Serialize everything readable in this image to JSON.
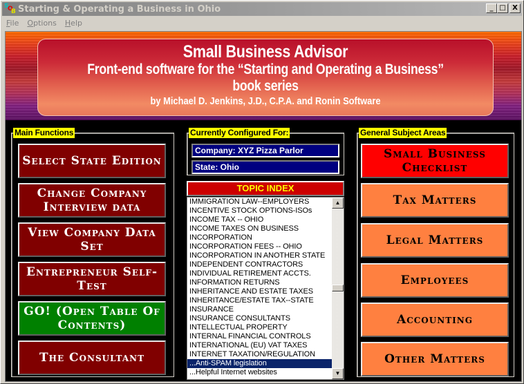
{
  "window": {
    "title": "Starting & Operating a Business in Ohio",
    "icon_letters": [
      "S",
      "O",
      "B"
    ],
    "controls": {
      "minimize": "_",
      "maximize": "□",
      "close": "X"
    }
  },
  "menu": [
    {
      "label": "File",
      "accel": "F",
      "rest": "ile"
    },
    {
      "label": "Options",
      "accel": "O",
      "rest": "ptions"
    },
    {
      "label": "Help",
      "accel": "H",
      "rest": "elp"
    }
  ],
  "banner": {
    "title": "Small Business Advisor",
    "subtitle_line1": "Front-end software for the “Starting and Operating a Business”",
    "subtitle_line2": "book series",
    "byline": "by Michael D. Jenkins, J.D., C.P.A. and Ronin Software"
  },
  "main_functions": {
    "label": "Main Functions",
    "buttons": [
      {
        "label": "Select State Edition",
        "style": "maroon"
      },
      {
        "label": "Change Company Interview data",
        "style": "maroon"
      },
      {
        "label": "View Company Data Set",
        "style": "maroon"
      },
      {
        "label": "Entrepreneur Self-Test",
        "style": "maroon"
      },
      {
        "label": "GO! (Open Table Of Contents)",
        "style": "green"
      },
      {
        "label": "The Consultant",
        "style": "maroon"
      }
    ]
  },
  "configured_for": {
    "label": "Currently Configured For:",
    "company": "Company: XYZ Pizza Parlor",
    "state": "State: Ohio"
  },
  "topic_index": {
    "header": "TOPIC INDEX",
    "items": [
      "IMMIGRATION LAW--EMPLOYERS",
      "INCENTIVE STOCK OPTIONS-ISOs",
      "INCOME TAX -- OHIO",
      "INCOME TAXES ON BUSINESS",
      "INCORPORATION",
      "INCORPORATION FEES -- OHIO",
      "INCORPORATION IN ANOTHER STATE",
      "INDEPENDENT CONTRACTORS",
      "INDIVIDUAL RETIREMENT ACCTS.",
      "INFORMATION RETURNS",
      "INHERITANCE AND ESTATE TAXES",
      "INHERITANCE/ESTATE TAX--STATE",
      "INSURANCE",
      "INSURANCE CONSULTANTS",
      "INTELLECTUAL PROPERTY",
      "INTERNAL FINANCIAL CONTROLS",
      "INTERNATIONAL (EU) VAT TAXES",
      "INTERNET TAXATION/REGULATION",
      "...Anti-SPAM legislation",
      "...Helpful Internet websites"
    ],
    "selected": "...Anti-SPAM legislation",
    "scroll_up": "▲",
    "scroll_down": "▼"
  },
  "subject_areas": {
    "label": "General Subject Areas",
    "buttons": [
      {
        "label": "Small Business Checklist",
        "style": "red"
      },
      {
        "label": "Tax Matters",
        "style": "orange"
      },
      {
        "label": "Legal Matters",
        "style": "orange"
      },
      {
        "label": "Employees",
        "style": "orange"
      },
      {
        "label": "Accounting",
        "style": "orange"
      },
      {
        "label": "Other Matters",
        "style": "orange"
      }
    ]
  },
  "colors": {
    "label_bg": "#ffff00",
    "maroon": "#800000",
    "green": "#008000",
    "red": "#ff0000",
    "orange": "#ff8040",
    "field_bg": "#000080",
    "selection": "#0a246a"
  }
}
